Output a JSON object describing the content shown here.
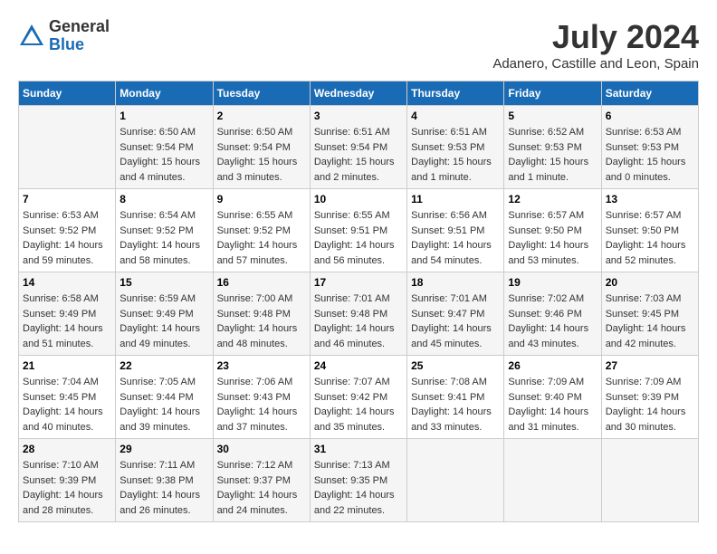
{
  "header": {
    "logo_general": "General",
    "logo_blue": "Blue",
    "month": "July 2024",
    "location": "Adanero, Castille and Leon, Spain"
  },
  "weekdays": [
    "Sunday",
    "Monday",
    "Tuesday",
    "Wednesday",
    "Thursday",
    "Friday",
    "Saturday"
  ],
  "weeks": [
    [
      {
        "day": "",
        "info": ""
      },
      {
        "day": "1",
        "info": "Sunrise: 6:50 AM\nSunset: 9:54 PM\nDaylight: 15 hours\nand 4 minutes."
      },
      {
        "day": "2",
        "info": "Sunrise: 6:50 AM\nSunset: 9:54 PM\nDaylight: 15 hours\nand 3 minutes."
      },
      {
        "day": "3",
        "info": "Sunrise: 6:51 AM\nSunset: 9:54 PM\nDaylight: 15 hours\nand 2 minutes."
      },
      {
        "day": "4",
        "info": "Sunrise: 6:51 AM\nSunset: 9:53 PM\nDaylight: 15 hours\nand 1 minute."
      },
      {
        "day": "5",
        "info": "Sunrise: 6:52 AM\nSunset: 9:53 PM\nDaylight: 15 hours\nand 1 minute."
      },
      {
        "day": "6",
        "info": "Sunrise: 6:53 AM\nSunset: 9:53 PM\nDaylight: 15 hours\nand 0 minutes."
      }
    ],
    [
      {
        "day": "7",
        "info": "Sunrise: 6:53 AM\nSunset: 9:52 PM\nDaylight: 14 hours\nand 59 minutes."
      },
      {
        "day": "8",
        "info": "Sunrise: 6:54 AM\nSunset: 9:52 PM\nDaylight: 14 hours\nand 58 minutes."
      },
      {
        "day": "9",
        "info": "Sunrise: 6:55 AM\nSunset: 9:52 PM\nDaylight: 14 hours\nand 57 minutes."
      },
      {
        "day": "10",
        "info": "Sunrise: 6:55 AM\nSunset: 9:51 PM\nDaylight: 14 hours\nand 56 minutes."
      },
      {
        "day": "11",
        "info": "Sunrise: 6:56 AM\nSunset: 9:51 PM\nDaylight: 14 hours\nand 54 minutes."
      },
      {
        "day": "12",
        "info": "Sunrise: 6:57 AM\nSunset: 9:50 PM\nDaylight: 14 hours\nand 53 minutes."
      },
      {
        "day": "13",
        "info": "Sunrise: 6:57 AM\nSunset: 9:50 PM\nDaylight: 14 hours\nand 52 minutes."
      }
    ],
    [
      {
        "day": "14",
        "info": "Sunrise: 6:58 AM\nSunset: 9:49 PM\nDaylight: 14 hours\nand 51 minutes."
      },
      {
        "day": "15",
        "info": "Sunrise: 6:59 AM\nSunset: 9:49 PM\nDaylight: 14 hours\nand 49 minutes."
      },
      {
        "day": "16",
        "info": "Sunrise: 7:00 AM\nSunset: 9:48 PM\nDaylight: 14 hours\nand 48 minutes."
      },
      {
        "day": "17",
        "info": "Sunrise: 7:01 AM\nSunset: 9:48 PM\nDaylight: 14 hours\nand 46 minutes."
      },
      {
        "day": "18",
        "info": "Sunrise: 7:01 AM\nSunset: 9:47 PM\nDaylight: 14 hours\nand 45 minutes."
      },
      {
        "day": "19",
        "info": "Sunrise: 7:02 AM\nSunset: 9:46 PM\nDaylight: 14 hours\nand 43 minutes."
      },
      {
        "day": "20",
        "info": "Sunrise: 7:03 AM\nSunset: 9:45 PM\nDaylight: 14 hours\nand 42 minutes."
      }
    ],
    [
      {
        "day": "21",
        "info": "Sunrise: 7:04 AM\nSunset: 9:45 PM\nDaylight: 14 hours\nand 40 minutes."
      },
      {
        "day": "22",
        "info": "Sunrise: 7:05 AM\nSunset: 9:44 PM\nDaylight: 14 hours\nand 39 minutes."
      },
      {
        "day": "23",
        "info": "Sunrise: 7:06 AM\nSunset: 9:43 PM\nDaylight: 14 hours\nand 37 minutes."
      },
      {
        "day": "24",
        "info": "Sunrise: 7:07 AM\nSunset: 9:42 PM\nDaylight: 14 hours\nand 35 minutes."
      },
      {
        "day": "25",
        "info": "Sunrise: 7:08 AM\nSunset: 9:41 PM\nDaylight: 14 hours\nand 33 minutes."
      },
      {
        "day": "26",
        "info": "Sunrise: 7:09 AM\nSunset: 9:40 PM\nDaylight: 14 hours\nand 31 minutes."
      },
      {
        "day": "27",
        "info": "Sunrise: 7:09 AM\nSunset: 9:39 PM\nDaylight: 14 hours\nand 30 minutes."
      }
    ],
    [
      {
        "day": "28",
        "info": "Sunrise: 7:10 AM\nSunset: 9:39 PM\nDaylight: 14 hours\nand 28 minutes."
      },
      {
        "day": "29",
        "info": "Sunrise: 7:11 AM\nSunset: 9:38 PM\nDaylight: 14 hours\nand 26 minutes."
      },
      {
        "day": "30",
        "info": "Sunrise: 7:12 AM\nSunset: 9:37 PM\nDaylight: 14 hours\nand 24 minutes."
      },
      {
        "day": "31",
        "info": "Sunrise: 7:13 AM\nSunset: 9:35 PM\nDaylight: 14 hours\nand 22 minutes."
      },
      {
        "day": "",
        "info": ""
      },
      {
        "day": "",
        "info": ""
      },
      {
        "day": "",
        "info": ""
      }
    ]
  ]
}
